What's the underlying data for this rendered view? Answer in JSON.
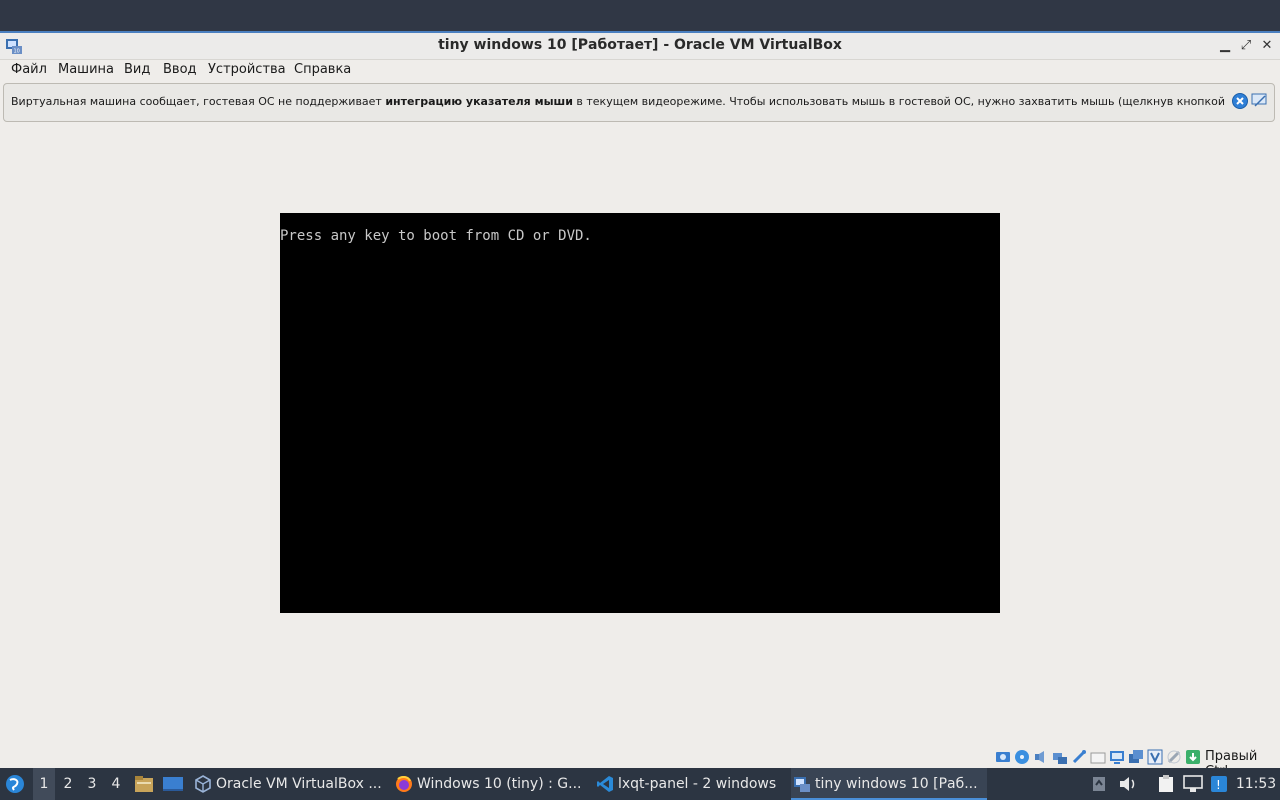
{
  "window": {
    "title": "tiny windows 10 [Работает] - Oracle VM VirtualBox",
    "minimize": "▁",
    "maximize": "⤢",
    "close": "✕"
  },
  "menu": [
    "Файл",
    "Машина",
    "Вид",
    "Ввод",
    "Устройства",
    "Справка"
  ],
  "notice": {
    "prefix": "Виртуальная машина сообщает, гостевая ОС не поддерживает ",
    "bold": "интеграцию указателя мыши",
    "suffix": " в текущем видеорежиме. Чтобы использовать мышь в гостевой ОС, нужно захватить мышь (щелкнув кнопкой"
  },
  "vm_screen": {
    "boot_message": "Press any key to boot from CD or DVD."
  },
  "statusbar": {
    "icons": [
      "hard-disk-icon",
      "optical-drive-icon",
      "audio-icon",
      "network-icon",
      "usb-icon",
      "shared-folders-icon",
      "display-icon",
      "video-capture-icon",
      "virtualization-icon",
      "mouse-integration-icon",
      "keyboard-capture-icon"
    ],
    "host_key": "Правый Ctrl"
  },
  "taskbar": {
    "desktops": [
      "1",
      "2",
      "3",
      "4"
    ],
    "active_desktop": "1",
    "tasks": [
      {
        "label": "Oracle VM VirtualBox ...",
        "icon": "virtualbox-icon"
      },
      {
        "label": "Windows 10 (tiny) : G...",
        "icon": "firefox-icon"
      },
      {
        "label": "lxqt-panel - 2 windows",
        "icon": "vscode-icon"
      },
      {
        "label": "tiny windows 10 [Раб...",
        "icon": "vm-window-icon"
      }
    ],
    "clock": "11:53"
  },
  "colors": {
    "taskbar": "#2c3542",
    "accent": "#4a8fd8",
    "window_bg": "#efedea"
  }
}
